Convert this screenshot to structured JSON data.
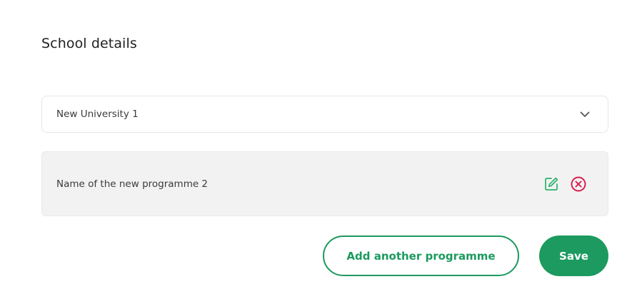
{
  "section": {
    "title": "School details"
  },
  "school_select": {
    "selected_value": "New University 1",
    "icon": "chevron-down-icon"
  },
  "programmes": [
    {
      "name": "Name of the new programme 2",
      "edit_icon": "edit-icon",
      "remove_icon": "remove-circle-icon"
    }
  ],
  "actions": {
    "add_label": "Add another programme",
    "save_label": "Save"
  },
  "colors": {
    "accent": "#1c9a5f",
    "danger": "#d81b4a",
    "row_bg": "#f2f2f2"
  }
}
